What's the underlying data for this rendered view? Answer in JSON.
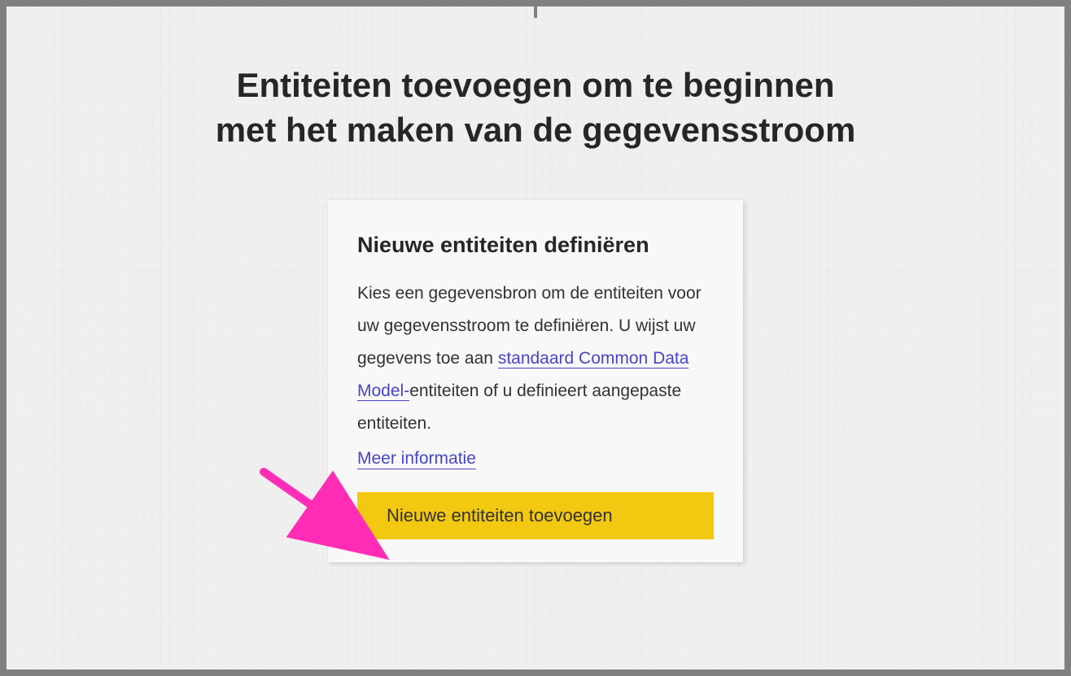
{
  "page": {
    "title_line1": "Entiteiten toevoegen om te beginnen",
    "title_line2": "met het maken van de gegevensstroom"
  },
  "card": {
    "title": "Nieuwe entiteiten definiëren",
    "description_part1": "Kies een gegevensbron om de entiteiten voor uw gegevensstroom te definiëren. U wijst uw gegevens toe aan ",
    "link_text": "standaard Common Data Model-",
    "description_part2": "entiteiten of u definieert aangepaste entiteiten.",
    "more_info_link": "Meer informatie",
    "button_label": "Nieuwe entiteiten toevoegen"
  },
  "annotation": {
    "arrow_color": "#ff2db5"
  }
}
